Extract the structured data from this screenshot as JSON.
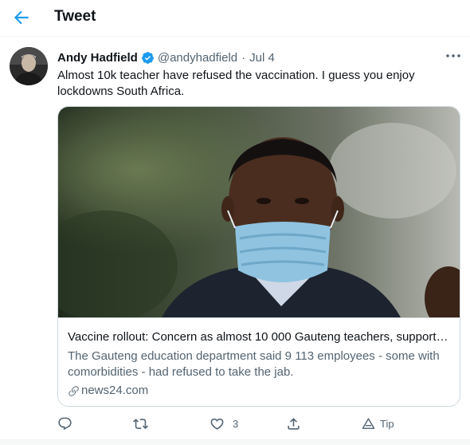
{
  "header": {
    "title": "Tweet",
    "back_icon": "back-arrow-icon",
    "accent": "#1d9bf0"
  },
  "tweet": {
    "author": "Andy Hadfield",
    "verified": true,
    "handle": "@andyhadfield",
    "separator": "·",
    "date": "Jul 4",
    "text": "Almost 10k teacher have refused the vaccination. I guess you enjoy lockdowns South Africa."
  },
  "card": {
    "title": "Vaccine rollout: Concern as almost 10 000 Gauteng teachers, support s...",
    "description": "The Gauteng education department said 9 113 employees - some with comorbidities - had refused to take the jab.",
    "domain": "news24.com"
  },
  "actions": {
    "reply_icon": "reply-icon",
    "retweet_icon": "retweet-icon",
    "like_icon": "like-icon",
    "like_count": "3",
    "share_icon": "share-icon",
    "tip_icon": "tip-icon",
    "tip_label": "Tip"
  },
  "colors": {
    "text": "#0f1419",
    "secondary": "#536471",
    "border": "#cfd9de",
    "verified": "#1d9bf0"
  }
}
